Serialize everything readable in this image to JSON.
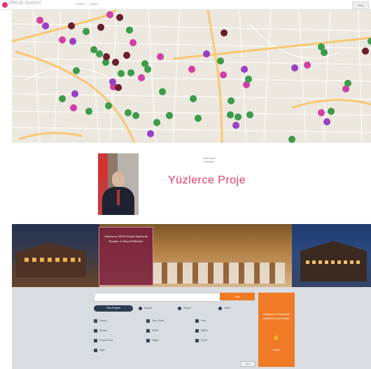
{
  "header": {
    "brand": "PROJE ÜLKESİ",
    "nav": [
      "Projeler",
      "İletişim"
    ],
    "button": "Giriş"
  },
  "map": {
    "colors": {
      "land": "#ece8df",
      "major_road": "#f7c873",
      "minor_road": "#ffffff",
      "pin_green": "#3d9b4a",
      "pin_purple": "#9b3fc4",
      "pin_magenta": "#d23fa6",
      "pin_maroon": "#6b1e2c"
    }
  },
  "profile": {
    "small_text": [
      "Ankara Mayor",
      "2005-2023"
    ],
    "headline": "Yüzlerce Proje"
  },
  "banner": {
    "text": "Ankara'ya 2023'e Kadar Yapılacak Projeler ve Hayal Edilenler"
  },
  "search": {
    "placeholder": "",
    "button": "Ara",
    "tabs": [
      "Tüm Projeler",
      "Ulaşım",
      "Sosyal",
      "Kültür"
    ],
    "categories": [
      "Ulaşım",
      "Spor Tesisi",
      "Park",
      "Altyapı",
      "Kültür",
      "Eğitim",
      "Sosyal Tesis",
      "Sağlık",
      "Çevre",
      "Diğer"
    ],
    "more": "Tümü",
    "cta_text": "Ankara'nın Projelerini keşfetmek için tıklayın",
    "cta_button": "Keşfet"
  }
}
